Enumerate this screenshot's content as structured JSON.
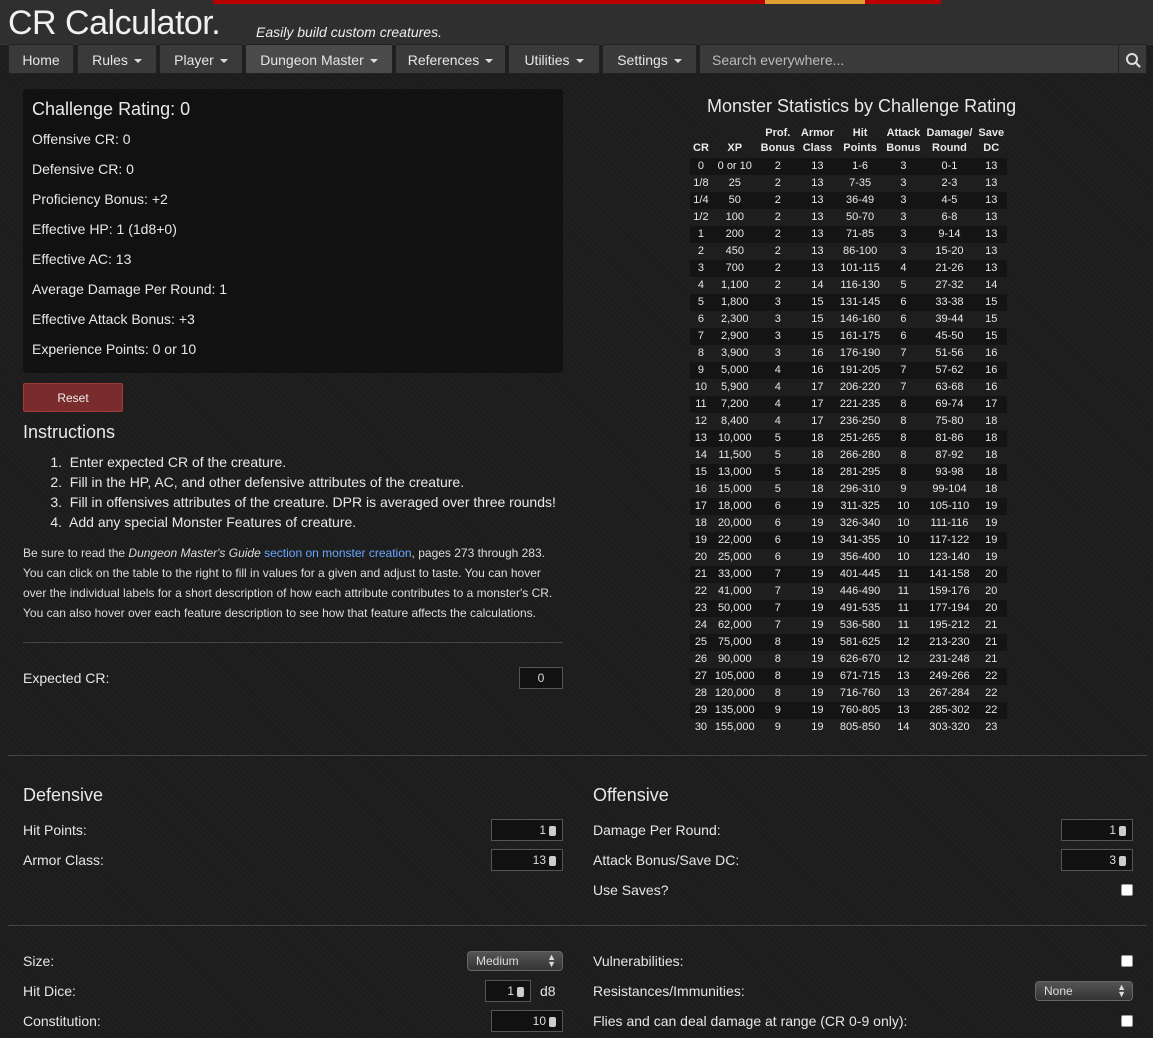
{
  "header": {
    "logo": "CR Calculator.",
    "tagline": "Easily build custom creatures."
  },
  "nav": {
    "items": [
      {
        "label": "Home",
        "caret": false
      },
      {
        "label": "Rules",
        "caret": true
      },
      {
        "label": "Player",
        "caret": true
      },
      {
        "label": "Dungeon Master",
        "caret": true
      },
      {
        "label": "References",
        "caret": true
      },
      {
        "label": "Utilities",
        "caret": true
      },
      {
        "label": "Settings",
        "caret": true
      }
    ],
    "search_placeholder": "Search everywhere..."
  },
  "cr_panel": {
    "title": "Challenge Rating: 0",
    "lines": [
      "Offensive CR: 0",
      "Defensive CR: 0",
      "Proficiency Bonus: +2",
      "Effective HP: 1 (1d8+0)",
      "Effective AC: 13",
      "Average Damage Per Round: 1",
      "Effective Attack Bonus: +3",
      "Experience Points: 0 or 10"
    ]
  },
  "reset_label": "Reset",
  "instructions": {
    "title": "Instructions",
    "steps": [
      "Enter expected CR of the creature.",
      "Fill in the HP, AC, and other defensive attributes of the creature.",
      "Fill in offensives attributes of the creature. DPR is averaged over three rounds!",
      "Add any special Monster Features of creature."
    ],
    "note_pre": "Be sure to read the ",
    "note_book": "Dungeon Master's Guide",
    "note_link": "section on monster creation",
    "note_post": ", pages 273 through 283. You can click on the table to the right to fill in values for a given and adjust to taste. You can hover over the individual labels for a short description of how each attribute contributes to a monster's CR. You can also hover over each feature description to see how that feature affects the calculations."
  },
  "expected_cr": {
    "label": "Expected CR:",
    "value": "0"
  },
  "defensive": {
    "title": "Defensive",
    "hp_label": "Hit Points:",
    "hp_value": "1",
    "ac_label": "Armor Class:",
    "ac_value": "13"
  },
  "offensive": {
    "title": "Offensive",
    "dpr_label": "Damage Per Round:",
    "dpr_value": "1",
    "atk_label": "Attack Bonus/Save DC:",
    "atk_value": "3",
    "saves_label": "Use Saves?"
  },
  "features": {
    "size_label": "Size:",
    "size_value": "Medium",
    "hd_label": "Hit Dice:",
    "hd_value": "1",
    "hd_unit": "d8",
    "con_label": "Constitution:",
    "con_value": "10",
    "vuln_label": "Vulnerabilities:",
    "resist_label": "Resistances/Immunities:",
    "resist_value": "None",
    "flies_label": "Flies and can deal damage at range (CR 0-9 only):"
  },
  "stats": {
    "title": "Monster Statistics by Challenge Rating",
    "headers": [
      [
        "CR"
      ],
      [
        "XP"
      ],
      [
        "Prof.",
        "Bonus"
      ],
      [
        "Armor",
        "Class"
      ],
      [
        "Hit",
        "Points"
      ],
      [
        "Attack",
        "Bonus"
      ],
      [
        "Damage/",
        "Round"
      ],
      [
        "Save",
        "DC"
      ]
    ],
    "rows": [
      [
        "0",
        "0 or 10",
        "2",
        "13",
        "1-6",
        "3",
        "0-1",
        "13"
      ],
      [
        "1/8",
        "25",
        "2",
        "13",
        "7-35",
        "3",
        "2-3",
        "13"
      ],
      [
        "1/4",
        "50",
        "2",
        "13",
        "36-49",
        "3",
        "4-5",
        "13"
      ],
      [
        "1/2",
        "100",
        "2",
        "13",
        "50-70",
        "3",
        "6-8",
        "13"
      ],
      [
        "1",
        "200",
        "2",
        "13",
        "71-85",
        "3",
        "9-14",
        "13"
      ],
      [
        "2",
        "450",
        "2",
        "13",
        "86-100",
        "3",
        "15-20",
        "13"
      ],
      [
        "3",
        "700",
        "2",
        "13",
        "101-115",
        "4",
        "21-26",
        "13"
      ],
      [
        "4",
        "1,100",
        "2",
        "14",
        "116-130",
        "5",
        "27-32",
        "14"
      ],
      [
        "5",
        "1,800",
        "3",
        "15",
        "131-145",
        "6",
        "33-38",
        "15"
      ],
      [
        "6",
        "2,300",
        "3",
        "15",
        "146-160",
        "6",
        "39-44",
        "15"
      ],
      [
        "7",
        "2,900",
        "3",
        "15",
        "161-175",
        "6",
        "45-50",
        "15"
      ],
      [
        "8",
        "3,900",
        "3",
        "16",
        "176-190",
        "7",
        "51-56",
        "16"
      ],
      [
        "9",
        "5,000",
        "4",
        "16",
        "191-205",
        "7",
        "57-62",
        "16"
      ],
      [
        "10",
        "5,900",
        "4",
        "17",
        "206-220",
        "7",
        "63-68",
        "16"
      ],
      [
        "11",
        "7,200",
        "4",
        "17",
        "221-235",
        "8",
        "69-74",
        "17"
      ],
      [
        "12",
        "8,400",
        "4",
        "17",
        "236-250",
        "8",
        "75-80",
        "18"
      ],
      [
        "13",
        "10,000",
        "5",
        "18",
        "251-265",
        "8",
        "81-86",
        "18"
      ],
      [
        "14",
        "11,500",
        "5",
        "18",
        "266-280",
        "8",
        "87-92",
        "18"
      ],
      [
        "15",
        "13,000",
        "5",
        "18",
        "281-295",
        "8",
        "93-98",
        "18"
      ],
      [
        "16",
        "15,000",
        "5",
        "18",
        "296-310",
        "9",
        "99-104",
        "18"
      ],
      [
        "17",
        "18,000",
        "6",
        "19",
        "311-325",
        "10",
        "105-110",
        "19"
      ],
      [
        "18",
        "20,000",
        "6",
        "19",
        "326-340",
        "10",
        "111-116",
        "19"
      ],
      [
        "19",
        "22,000",
        "6",
        "19",
        "341-355",
        "10",
        "117-122",
        "19"
      ],
      [
        "20",
        "25,000",
        "6",
        "19",
        "356-400",
        "10",
        "123-140",
        "19"
      ],
      [
        "21",
        "33,000",
        "7",
        "19",
        "401-445",
        "11",
        "141-158",
        "20"
      ],
      [
        "22",
        "41,000",
        "7",
        "19",
        "446-490",
        "11",
        "159-176",
        "20"
      ],
      [
        "23",
        "50,000",
        "7",
        "19",
        "491-535",
        "11",
        "177-194",
        "20"
      ],
      [
        "24",
        "62,000",
        "7",
        "19",
        "536-580",
        "11",
        "195-212",
        "21"
      ],
      [
        "25",
        "75,000",
        "8",
        "19",
        "581-625",
        "12",
        "213-230",
        "21"
      ],
      [
        "26",
        "90,000",
        "8",
        "19",
        "626-670",
        "12",
        "231-248",
        "21"
      ],
      [
        "27",
        "105,000",
        "8",
        "19",
        "671-715",
        "13",
        "249-266",
        "22"
      ],
      [
        "28",
        "120,000",
        "8",
        "19",
        "716-760",
        "13",
        "267-284",
        "22"
      ],
      [
        "29",
        "135,000",
        "9",
        "19",
        "760-805",
        "13",
        "285-302",
        "22"
      ],
      [
        "30",
        "155,000",
        "9",
        "19",
        "805-850",
        "14",
        "303-320",
        "23"
      ]
    ]
  }
}
